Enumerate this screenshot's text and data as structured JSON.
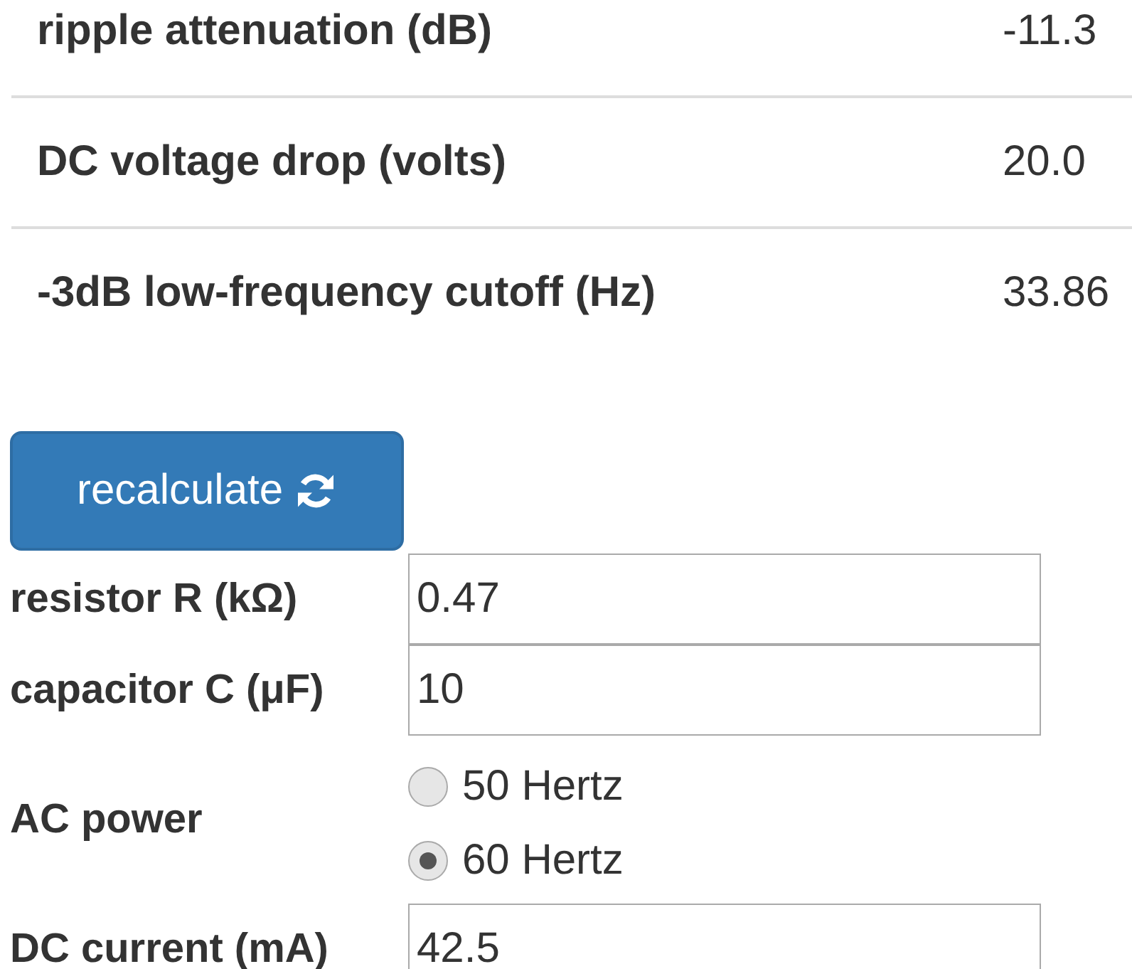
{
  "results": [
    {
      "label": "ripple attenuation (dB)",
      "value": "-11.3"
    },
    {
      "label": "DC voltage drop (volts)",
      "value": "20.0"
    },
    {
      "label": "-3dB low-frequency cutoff (Hz)",
      "value": "33.86"
    }
  ],
  "button": {
    "label": "recalculate"
  },
  "form": [
    {
      "kind": "input",
      "label": "resistor R (kΩ)",
      "value": "0.47"
    },
    {
      "kind": "input",
      "label": "capacitor C (μF)",
      "value": "10"
    },
    {
      "kind": "radio",
      "label": "AC power",
      "options": [
        {
          "label": "50 Hertz",
          "selected": false
        },
        {
          "label": "60 Hertz",
          "selected": true
        }
      ]
    },
    {
      "kind": "input",
      "label": "DC current (mA)",
      "value": "42.5"
    }
  ]
}
